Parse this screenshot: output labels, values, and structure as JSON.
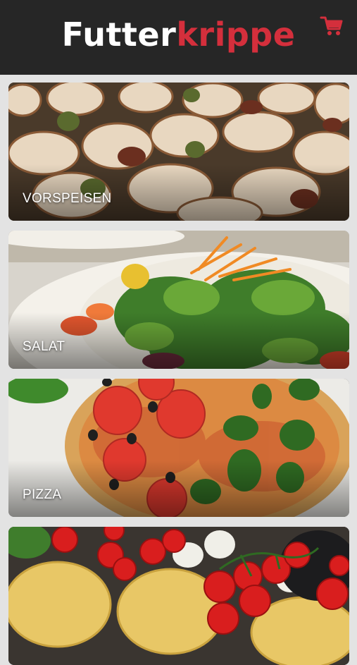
{
  "header": {
    "logo_part1": "Futter",
    "logo_part2": "krippe",
    "brand_color": "#d42f3c",
    "cart_icon": "shopping-cart-icon"
  },
  "categories": [
    {
      "label": "VORSPEISEN"
    },
    {
      "label": "SALAT"
    },
    {
      "label": "PIZZA"
    },
    {
      "label": ""
    }
  ]
}
